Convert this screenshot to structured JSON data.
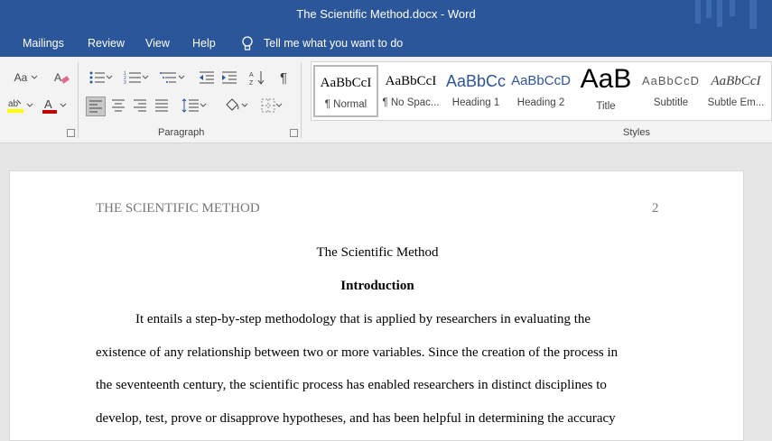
{
  "window": {
    "title": "The Scientific Method.docx  -  Word"
  },
  "menu": {
    "tabs": [
      "Mailings",
      "Review",
      "View",
      "Help"
    ],
    "tell_me": "Tell me what you want to do"
  },
  "ribbon": {
    "font_group": {
      "change_case": "Aa"
    },
    "paragraph_group_label": "Paragraph",
    "styles_group_label": "Styles",
    "styles": [
      {
        "preview": "AaBbCcI",
        "label": "¶ Normal",
        "selected": true
      },
      {
        "preview": "AaBbCcI",
        "label": "¶ No Spac..."
      },
      {
        "preview": "AaBbCc",
        "label": "Heading 1"
      },
      {
        "preview": "AaBbCcD",
        "label": "Heading 2"
      },
      {
        "preview": "AaB",
        "label": "Title"
      },
      {
        "preview": "AaBbCcD",
        "label": "Subtitle"
      },
      {
        "preview": "AaBbCcI",
        "label": "Subtle Em..."
      }
    ]
  },
  "document": {
    "running_head": "THE SCIENTIFIC METHOD",
    "page_number": "2",
    "title": "The Scientific Method",
    "heading": "Introduction",
    "lines": [
      "It entails a step-by-step methodology that is applied by researchers in evaluating the",
      "existence of any relationship between two or more variables. Since the creation of the process in",
      "the seventeenth century, the scientific process has enabled researchers in distinct disciplines to",
      "develop, test, prove or disapprove hypotheses, and has been helpful in determining the accuracy"
    ]
  },
  "colors": {
    "title_bar": "#2b579a",
    "ribbon": "#f3f3f3",
    "canvas": "#e6e6e6"
  }
}
